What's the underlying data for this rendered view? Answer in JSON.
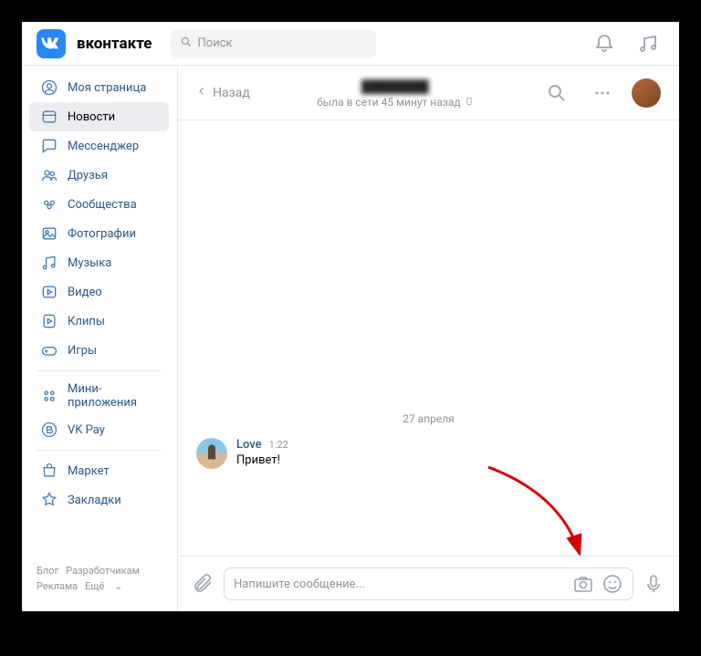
{
  "header": {
    "brand": "вконтакте",
    "search_placeholder": "Поиск"
  },
  "sidebar": {
    "items": [
      {
        "icon": "user-icon",
        "label": "Моя страница"
      },
      {
        "icon": "news-icon",
        "label": "Новости",
        "active": true
      },
      {
        "icon": "chat-icon",
        "label": "Мессенджер"
      },
      {
        "icon": "friends-icon",
        "label": "Друзья"
      },
      {
        "icon": "groups-icon",
        "label": "Сообщества"
      },
      {
        "icon": "photo-icon",
        "label": "Фотографии"
      },
      {
        "icon": "music-icon",
        "label": "Музыка"
      },
      {
        "icon": "video-icon",
        "label": "Видео"
      },
      {
        "icon": "clips-icon",
        "label": "Клипы"
      },
      {
        "icon": "games-icon",
        "label": "Игры"
      }
    ],
    "secondary": [
      {
        "icon": "miniapps-icon",
        "label": "Мини-приложения"
      },
      {
        "icon": "vkpay-icon",
        "label": "VK Pay"
      }
    ],
    "tertiary": [
      {
        "icon": "market-icon",
        "label": "Маркет"
      },
      {
        "icon": "bookmark-icon",
        "label": "Закладки"
      }
    ],
    "footer": {
      "blog": "Блог",
      "developers": "Разработчикам",
      "ads": "Реклама",
      "more": "Ещё"
    }
  },
  "chat": {
    "back": "Назад",
    "contact_name": "████████",
    "status": "была в сети 45 минут назад",
    "date": "27 апреля",
    "messages": [
      {
        "sender": "Love",
        "time": "1:22",
        "text": "Привет!"
      }
    ],
    "composer_placeholder": "Напишите сообщение..."
  },
  "annotation": {
    "arrow_color": "#d40000"
  }
}
